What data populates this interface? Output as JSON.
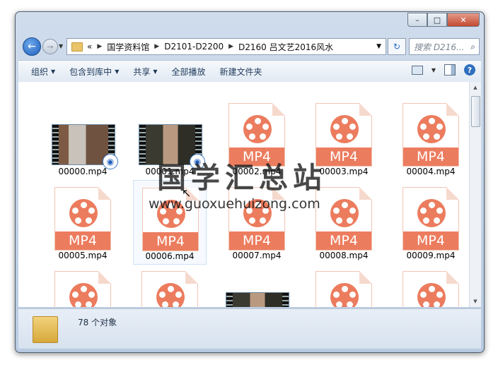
{
  "window": {
    "caption_minimize": "–",
    "caption_maximize": "□",
    "caption_close": "✕"
  },
  "nav": {
    "back_icon": "←",
    "forward_icon": "→",
    "breadcrumb_prefix": "«",
    "path": [
      "国学资料馆",
      "D2101-D2200",
      "D2160 吕文艺2016风水"
    ],
    "search_placeholder": "搜索 D216...",
    "refresh_icon": "↻",
    "search_icon": "⌕"
  },
  "toolbar": {
    "organize": "组织",
    "include_library": "包含到库中",
    "share": "共享",
    "play_all": "全部播放",
    "new_folder": "新建文件夹",
    "help_icon": "?"
  },
  "files": [
    {
      "name": "00000.mp4",
      "kind": "video"
    },
    {
      "name": "00001.mp4",
      "kind": "video"
    },
    {
      "name": "00002.mp4",
      "kind": "mp4"
    },
    {
      "name": "00003.mp4",
      "kind": "mp4"
    },
    {
      "name": "00004.mp4",
      "kind": "mp4"
    },
    {
      "name": "00005.mp4",
      "kind": "mp4"
    },
    {
      "name": "00006.mp4",
      "kind": "mp4"
    },
    {
      "name": "00007.mp4",
      "kind": "mp4"
    },
    {
      "name": "00008.mp4",
      "kind": "mp4"
    },
    {
      "name": "00009.mp4",
      "kind": "mp4"
    },
    {
      "name": "",
      "kind": "mp4"
    },
    {
      "name": "",
      "kind": "mp4"
    },
    {
      "name": "",
      "kind": "video"
    },
    {
      "name": "",
      "kind": "mp4"
    },
    {
      "name": "",
      "kind": "mp4"
    }
  ],
  "mp4_label": "MP4",
  "watermark": {
    "title": "国学汇总站",
    "url": "www.guoxuehuizong.com"
  },
  "status": {
    "count": "78 个对象"
  },
  "colors": {
    "mp4_accent": "#ec7c5e",
    "selection": "#cde0f5"
  }
}
